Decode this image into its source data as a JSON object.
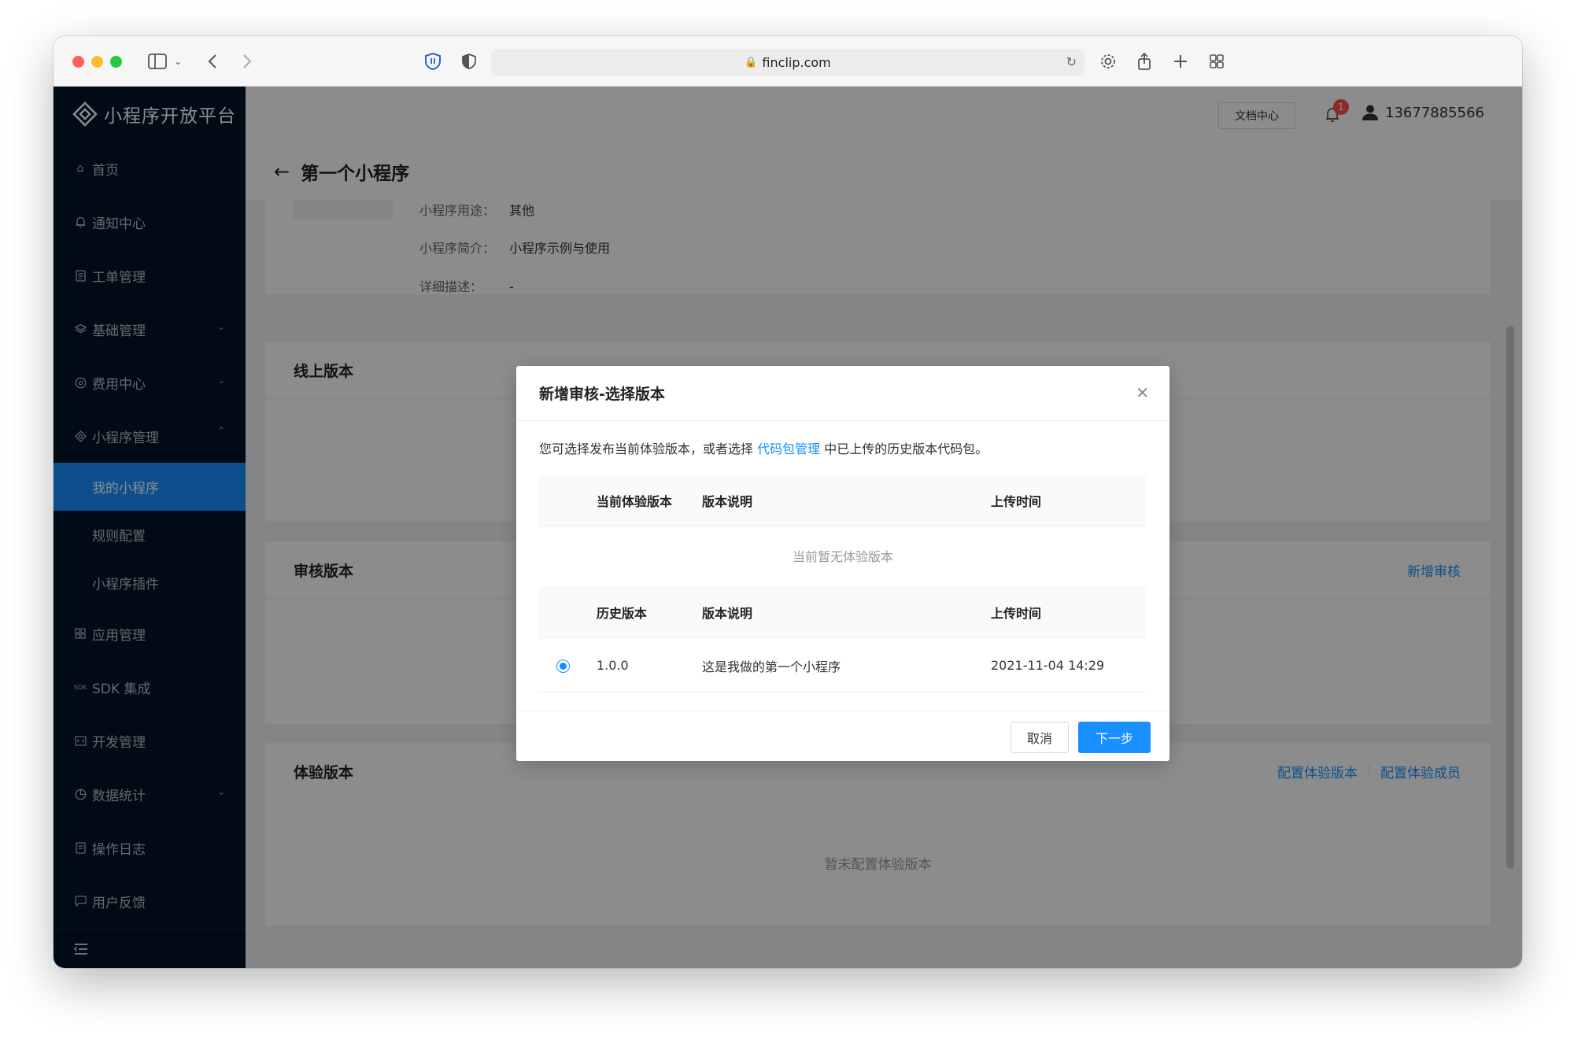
{
  "browser": {
    "url": "finclip.com"
  },
  "sidebar": {
    "logo": "小程序开放平台",
    "items": [
      {
        "label": "首页",
        "icon": "home-icon"
      },
      {
        "label": "通知中心",
        "icon": "bell-icon"
      },
      {
        "label": "工单管理",
        "icon": "ticket-icon"
      },
      {
        "label": "基础管理",
        "icon": "layers-icon",
        "expandable": true
      },
      {
        "label": "费用中心",
        "icon": "coin-icon",
        "expandable": true
      },
      {
        "label": "小程序管理",
        "icon": "diamond-icon",
        "expanded": true
      }
    ],
    "subitems": [
      {
        "label": "我的小程序",
        "active": true
      },
      {
        "label": "规则配置"
      },
      {
        "label": "小程序插件"
      }
    ],
    "items_after": [
      {
        "label": "应用管理",
        "icon": "grid-icon"
      },
      {
        "label": "SDK 集成",
        "icon": "sdk-icon",
        "icon_text": "SDK"
      },
      {
        "label": "开发管理",
        "icon": "code-icon"
      },
      {
        "label": "数据统计",
        "icon": "pie-chart-icon",
        "expandable": true
      },
      {
        "label": "操作日志",
        "icon": "log-icon"
      },
      {
        "label": "用户反馈",
        "icon": "feedback-icon"
      }
    ]
  },
  "header": {
    "doc_center": "文档中心",
    "notification_count": "1",
    "user_phone": "13677885566"
  },
  "page_title": "第一个小程序",
  "info": {
    "purpose_label": "小程序用途：",
    "purpose_value": "其他",
    "intro_label": "小程序简介：",
    "intro_value": "小程序示例与使用",
    "detail_label": "详细描述：",
    "detail_value": "-"
  },
  "sections": {
    "online_title": "线上版本",
    "review_title": "审核版本",
    "review_link": "新增审核",
    "trial_title": "体验版本",
    "trial_link_1": "配置体验版本",
    "trial_link_2": "配置体验成员",
    "trial_empty": "暂未配置体验版本"
  },
  "modal": {
    "title": "新增审核-选择版本",
    "desc_prefix": "您可选择发布当前体验版本，或者选择 ",
    "desc_link": "代码包管理",
    "desc_suffix": " 中已上传的历史版本代码包。",
    "current_table": {
      "headers": [
        "当前体验版本",
        "版本说明",
        "上传时间"
      ],
      "empty": "当前暂无体验版本"
    },
    "history_table": {
      "headers": [
        "历史版本",
        "版本说明",
        "上传时间"
      ],
      "rows": [
        {
          "version": "1.0.0",
          "desc": "这是我做的第一个小程序",
          "time": "2021-11-04 14:29",
          "selected": true
        }
      ]
    },
    "cancel": "取消",
    "next": "下一步"
  }
}
